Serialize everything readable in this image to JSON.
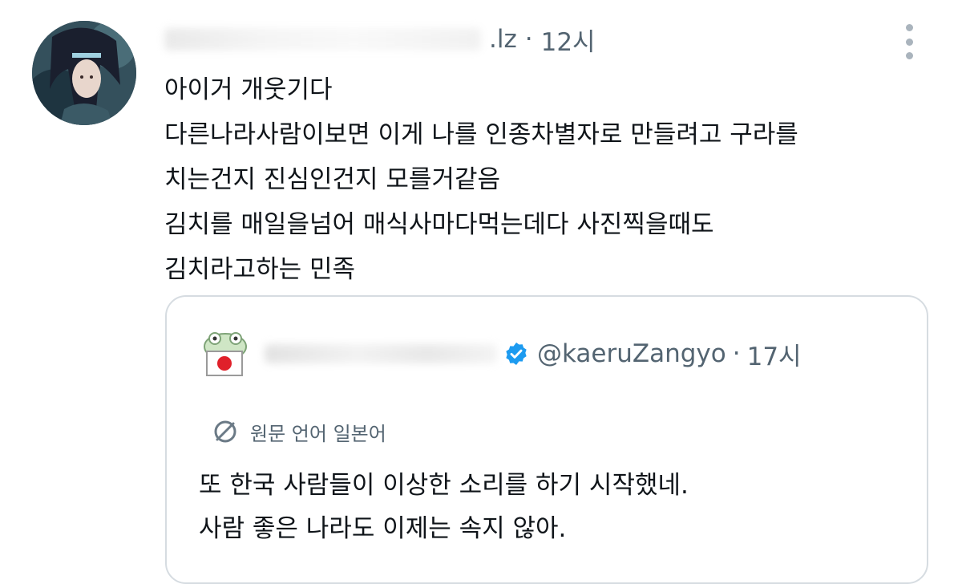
{
  "tweet": {
    "handle_suffix": ".lz",
    "separator": "·",
    "time": "12시",
    "lines": [
      "아이거 개웃기다",
      "다른나라사람이보면 이게 나를 인종차별자로 만들려고 구라를",
      "치는건지 진심인건지 모를거같음",
      "김치를 매일을넘어 매식사마다먹는데다 사진찍을때도",
      "김치라고하는 민족"
    ]
  },
  "quote": {
    "handle": "@kaeruZangyo",
    "separator": "·",
    "time": "17시",
    "translate_label": "원문 언어 일본어",
    "lines": [
      "또 한국 사람들이 이상한 소리를 하기 시작했네.",
      "사람 좋은 나라도 이제는 속지 않아."
    ]
  },
  "icons": {
    "more": "more-vertical-icon",
    "verified": "verified-badge-icon",
    "translate": "translate-icon"
  },
  "colors": {
    "text": "#0f1419",
    "secondary": "#536471",
    "verified": "#1d9bf0",
    "border": "#d6dce1"
  }
}
